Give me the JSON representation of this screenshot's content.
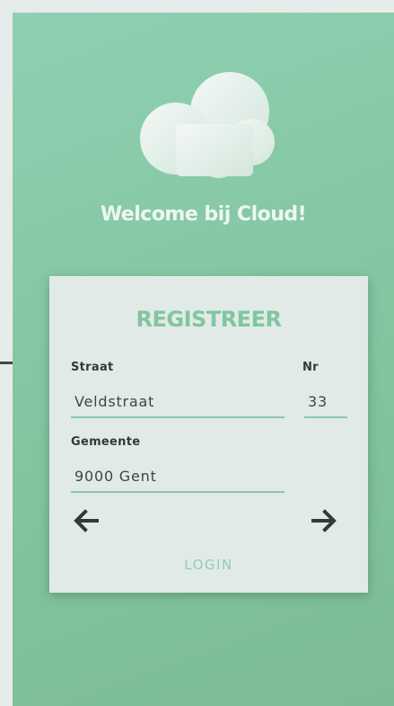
{
  "welcome": {
    "title": "Welcome bij Cloud!"
  },
  "register_card": {
    "title": "REGISTREER",
    "street": {
      "label": "Straat",
      "value": "Veldstraat"
    },
    "number": {
      "label": "Nr",
      "value": "33"
    },
    "city": {
      "label": "Gemeente",
      "value": "9000 Gent"
    },
    "login_link": "LOGIN"
  },
  "icons": {
    "logo": "cloud-icon",
    "back": "arrow-left-icon",
    "next": "arrow-right-icon"
  },
  "colors": {
    "background": "#e5ecea",
    "panel": "#86c9a4",
    "card": "#e2eae8",
    "accent": "#80c6a0",
    "text_dark": "#2f3b38",
    "welcome_text": "#eef7f3"
  }
}
